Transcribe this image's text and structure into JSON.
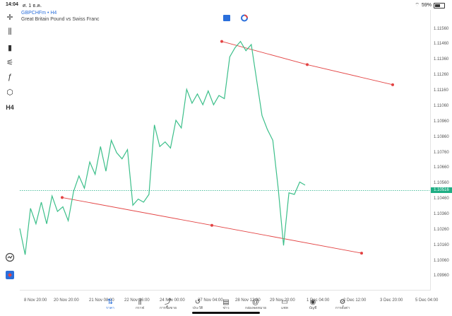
{
  "status": {
    "time": "14:04",
    "date": "ศ. 1 ธ.ค.",
    "battery": "59%"
  },
  "symbol": {
    "name": "GBPCHFm • H4",
    "description": "Great Britain Pound vs Swiss Franc"
  },
  "left_toolbar": [
    {
      "name": "crosshair-icon",
      "glyph": "✛"
    },
    {
      "name": "candlestick-icon",
      "glyph": "⫼"
    },
    {
      "name": "bars-icon",
      "glyph": "▮"
    },
    {
      "name": "indicators-icon",
      "glyph": "⚟"
    },
    {
      "name": "function-icon",
      "glyph": "ƒ"
    },
    {
      "name": "objects-icon",
      "glyph": "⬡"
    },
    {
      "name": "timeframe-h4",
      "glyph": "H4"
    }
  ],
  "price_axis": {
    "ticks": [
      "1.11560",
      "1.11460",
      "1.11360",
      "1.11260",
      "1.11160",
      "1.11060",
      "1.10960",
      "1.10860",
      "1.10760",
      "1.10660",
      "1.10560",
      "1.10460",
      "1.10360",
      "1.10260",
      "1.10160",
      "1.10060",
      "1.09960"
    ],
    "current": "1.10516"
  },
  "time_axis": {
    "ticks": [
      "8 Nov 20:00",
      "20 Nov 20:00",
      "21 Nov 08:00",
      "22 Nov 16:00",
      "24 Nov 00:00",
      "27 Nov 04:00",
      "28 Nov 12:00",
      "29 Nov 20:00",
      "1 Dec 04:00",
      "2 Dec 12:00",
      "3 Dec 20:00",
      "5 Dec 04:00"
    ]
  },
  "chart_data": {
    "type": "line",
    "series": [
      {
        "values": [
          1.1027,
          1.101,
          1.104,
          1.103,
          1.1044,
          1.103,
          1.1048,
          1.1038,
          1.1041,
          1.1032,
          1.1051,
          1.1061,
          1.1053,
          1.107,
          1.1062,
          1.108,
          1.1064,
          1.1084,
          1.1076,
          1.1072,
          1.1078,
          1.1042,
          1.1046,
          1.1044,
          1.1049,
          1.1094,
          1.108,
          1.1083,
          1.1079,
          1.1097,
          1.1092,
          1.1117,
          1.1108,
          1.1114,
          1.1107,
          1.1116,
          1.1107,
          1.1113,
          1.1111,
          1.1138,
          1.1144,
          1.1148,
          1.1142,
          1.1146,
          1.1123,
          1.11,
          1.1091,
          1.1084,
          1.1053,
          1.1016,
          1.105,
          1.1049,
          1.1057,
          1.1055
        ]
      }
    ],
    "trendlines": [
      {
        "color": "#e34343",
        "points": [
          [
            0,
            1.1148
          ],
          [
            10,
            1.1133
          ],
          [
            20,
            1.112
          ]
        ]
      },
      {
        "color": "#e34343",
        "points": [
          [
            0,
            1.1047
          ],
          [
            10,
            1.1029
          ],
          [
            20,
            1.1011
          ]
        ]
      }
    ],
    "ylim": [
      1.099,
      1.1162
    ],
    "colors": {
      "line": "#3cbf8a",
      "trend": "#e34343",
      "current": "#1fae84"
    }
  },
  "bottom_nav": [
    {
      "name": "nav-quotes",
      "icon": "⇅",
      "label": "ราคา",
      "active": true
    },
    {
      "name": "nav-chart",
      "icon": "⫼",
      "label": "กราฟ",
      "active": false
    },
    {
      "name": "nav-trade",
      "icon": "⤴",
      "label": "การซื้อขาย",
      "active": false
    },
    {
      "name": "nav-history",
      "icon": "↺",
      "label": "ประวัติ",
      "active": false
    },
    {
      "name": "nav-news",
      "icon": "▤",
      "label": "ข่าว",
      "active": false
    },
    {
      "name": "nav-mailbox",
      "icon": "@",
      "label": "กล่องจดหมาย",
      "active": false
    },
    {
      "name": "nav-chat",
      "icon": "▭",
      "label": "แชท",
      "active": false
    },
    {
      "name": "nav-accounts",
      "icon": "◉",
      "label": "บัญชี",
      "active": false
    },
    {
      "name": "nav-settings",
      "icon": "⚙",
      "label": "การตั้งค่า",
      "active": false
    }
  ]
}
